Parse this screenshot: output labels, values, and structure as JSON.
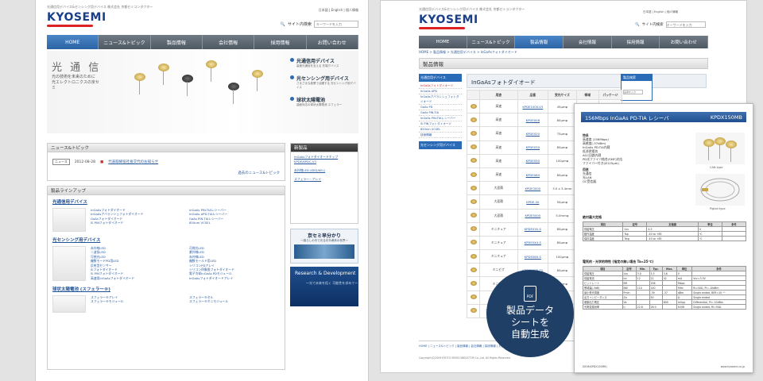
{
  "left": {
    "tagline": "光通信用デバイス&センシング用デバイス 株式会社 京都セミコンダクター",
    "logo": "KYOSEMI",
    "top_links": "日本語 | English | 個人情報",
    "search_label": "サイト内検索",
    "search_placeholder": "キーワードを入力",
    "nav": [
      "HOME",
      "ニュース&トピック",
      "製品情報",
      "会社情報",
      "採用情報",
      "お問い合わせ"
    ],
    "hero_title": "光 通 信",
    "hero_sub": "光の技術を未来のために 光エレクトロニクスの京セミ",
    "hero_items": [
      {
        "title": "光通信用デバイス",
        "desc": "高速光通信を支える 先端デバイス"
      },
      {
        "title": "光センシング用デバイス",
        "desc": "さまざまな産業で活躍する 光センシング用デバイス"
      },
      {
        "title": "球状太陽電池",
        "desc": "曲面対応の球状太陽電池 スフェラー"
      }
    ],
    "news_head": "ニュース&トピック",
    "news_tag": "ニュース",
    "news_date": "2012-08-28",
    "news_text": "代表取締役社長交代のお知らせ",
    "news_more": "過去のニュース&トピック",
    "new_head": "新製品",
    "new_items": [
      "InGaAsフォトダイオードチップ KPDE/KPDC-V3",
      "赤外線LED (KED/KEL)",
      "スフェラー・アレイ"
    ],
    "lineup_head": "製品ラインアップ",
    "cats": [
      {
        "title": "光通信用デバイス",
        "col1": [
          "InGaAsフォトダイオード",
          "InGaAsアバランシェフォトダイオード",
          "GaAsフォトダイオード",
          "Si PINフォトダイオード"
        ],
        "col2": [
          "InGaAs PIN-TIAレシーバー",
          "InGaAs APD-TIAレシーバー",
          "GaAs PIN-TIAレシーバー",
          "850nm VCSEL"
        ]
      },
      {
        "title": "光センシング用デバイス",
        "col1": [
          "赤外線LED",
          "二波長LED",
          "可視光LED",
          "複数モードPD用LED",
          "反射型センサー",
          "Siフォトダイオード",
          "Si PINフォトダイオード",
          "高速用InGaAsフォトダイオード"
        ],
        "col2": [
          "可視光LED",
          "紫外線LED",
          "赤外線LED",
          "複数モールド用LED",
          "シリコンPDアレイ",
          "シリコン四象限フォトダイオード",
          "電子冷却InGaAs PDモジュール",
          "InGaAsフォトダイオードアレイ"
        ]
      },
      {
        "title": "球状太陽電池 (スフェラー®)",
        "col1": [
          "スフェラー®アレイ",
          "スフェラー®モジュール"
        ],
        "col2": [
          "スフェラー®セル",
          "スフェラー®ミニモジュール"
        ]
      }
    ],
    "banner_kyo_title": "京セミ早分かり",
    "banner_kyo_sub": "～暮らしの中で光る光半導体の世界～",
    "banner_rd_title": "Research & Development",
    "banner_rd_sub": "～光で未来を拓く 可能性を求めて～"
  },
  "right": {
    "nav": [
      "HOME",
      "ニュース&トピック",
      "製品情報",
      "会社情報",
      "採用情報",
      "お問い合わせ"
    ],
    "crumb": "HOME > 製品情報 > 光通信用デバイス > InGaAsフォトダイオード",
    "head": "製品情報",
    "side_head": "光通信用デバイス",
    "side_items": [
      "InGaAsフォトダイオード",
      "InGaAs APD",
      "InGaAsアバランシェフォトダイオード",
      "GaAs PD",
      "GaAs PIN-TIA",
      "InGaAs PIN-TIAレシーバー",
      "Si PINフォトダイオード",
      "850nm VCSEL",
      "技術情報"
    ],
    "side_head2": "光センシング用デバイス",
    "table_title": "InGaAsフォトダイオード",
    "cols": [
      "",
      "用途",
      "品番",
      "受光サイズ",
      "帯域",
      "パッケージ"
    ],
    "rows": [
      [
        "高速",
        "KPDE1000-V3",
        "45μmφ",
        "2.5Gbps"
      ],
      [
        "高速",
        "KPDE008",
        "80μmφ",
        "2.5Gbps"
      ],
      [
        "高速",
        "KPDE020",
        "75μmφ",
        "2.5Gbps"
      ],
      [
        "高速",
        "KPDE030",
        "80μmφ",
        "2.5Gbps"
      ],
      [
        "高速",
        "KPDE050",
        "100μmφ",
        "2.5Gbps"
      ],
      [
        "高速",
        "KPDE080",
        "80μmφ",
        "1.25Gbps"
      ],
      [
        "大面積",
        "KPDE3000",
        "3.0 x 3.4mm",
        "0.5MHz"
      ],
      [
        "大面積",
        "KPDE-50",
        "50μmφ",
        "1Gbps"
      ],
      [
        "大面積",
        "KPDE5000",
        "5.0mmφ",
        "10MHz"
      ],
      [
        "ミニチュア",
        "KPDE030-S",
        "80μmφ",
        "2.5Gbps"
      ],
      [
        "ミニチュア",
        "KPDE0X4-S",
        "80μmφ",
        "2.5Gbps"
      ],
      [
        "ミニチュア",
        "KPDE08X-S",
        "100μmφ",
        "1Gbps"
      ],
      [
        "ミニピグ",
        "KPDE008B-TU",
        "80μmφ",
        "2.5Gbps"
      ],
      [
        "ミニピグ",
        "KPDE030M-TU",
        "80μmφ",
        "2.5Gbps"
      ],
      [
        "レンズ",
        "KPDE008L",
        "80μmφ",
        "2.5Gbps"
      ],
      [
        "プラスチックレンズ",
        "KPDE008L",
        "80μmφ",
        "2.5Gbps"
      ]
    ],
    "prod_search_head": "製品検索",
    "prod_search_placeholder": "品番を入力",
    "footer_links": "HOME | ニュース&トピック | 製品情報 | 会社情報 | 採用情報 | お問い合わせ | 個人情報 | サイトマップ",
    "copyright": "Copyright(C)2009 KYOTO SEMICONDUCTOR Co.,Ltd. All Rights Reserved."
  },
  "sheet": {
    "title": "156Mbps InGaAs PD-TIA レシーバ",
    "model": "KPDX150MB",
    "features_head": "特長",
    "features": [
      "高速度 (156Mbps)",
      "高感度(-37dBm)",
      "InGaAs PD-TIA内蔵",
      "低消費電流",
      "AGC回路内蔵",
      "PD光ファイバ結合(SMF)対応",
      "ファイバー付き(Ø125μm)"
    ],
    "apps_head": "用途",
    "apps": [
      "光通信",
      "光LAN",
      "OC受信器"
    ],
    "cap1": "CAN type",
    "cap2": "Pigtail type",
    "abs_head": "絶対最大定格",
    "abs_cols": [
      "項目",
      "記号",
      "定格値",
      "単位",
      "条件"
    ],
    "abs_rows": [
      [
        "供給電圧",
        "Vcc",
        "4.5",
        "V",
        ""
      ],
      [
        "動作温度",
        "Top",
        "-40 to +85",
        "℃",
        ""
      ],
      [
        "保存温度",
        "Tstg",
        "-40 to +85",
        "℃",
        ""
      ]
    ],
    "eo_head": "電気的・光学的特性 (指定の無い場合 Ta=25℃)",
    "eo_cols": [
      "項目",
      "記号",
      "Min.",
      "Typ.",
      "Max.",
      "単位",
      "条件"
    ],
    "eo_rows": [
      [
        "供給電圧",
        "Vcc",
        "3.0",
        "3.3",
        "3.6",
        "V",
        ""
      ],
      [
        "供給電流",
        "Icc",
        "12",
        "22",
        "42",
        "mA",
        "Vcc=3.3V"
      ],
      [
        "ビットレート",
        "BR",
        "",
        "156",
        "",
        "Mbps",
        ""
      ],
      [
        "帯域幅(-3dB)",
        "BW",
        "110",
        "140",
        "",
        "MHz",
        "Ri=50Ω, Pi=-10dBm"
      ],
      [
        "最小受光感度",
        "Pmin",
        "",
        "-39",
        "-37",
        "dBm",
        "Single ended, BER=10⁻¹⁰"
      ],
      [
        "出力インピーダンス",
        "Zo",
        "",
        "50",
        "",
        "Ω",
        "Single ended"
      ],
      [
        "差動出力電圧",
        "Vo",
        "",
        "",
        "800",
        "mVpp",
        "Differential, Pi=-10dBm"
      ],
      [
        "光電変換効率",
        "η",
        "22.8",
        "26.0",
        "",
        "kV/W",
        "Single ended, Ri=50Ω"
      ]
    ],
    "foot_left": "DE08(KPDX150MB)",
    "foot_right": "www.kyosemi.co.jp"
  },
  "badge": {
    "pdf": "PDF",
    "lines": [
      "製品データ",
      "シートを",
      "自動生成"
    ]
  },
  "colors": {
    "nav": "#5a6570",
    "nav_active": "#2c64a4",
    "badge": "#1f3f66",
    "brand": "#1a3f8a"
  }
}
